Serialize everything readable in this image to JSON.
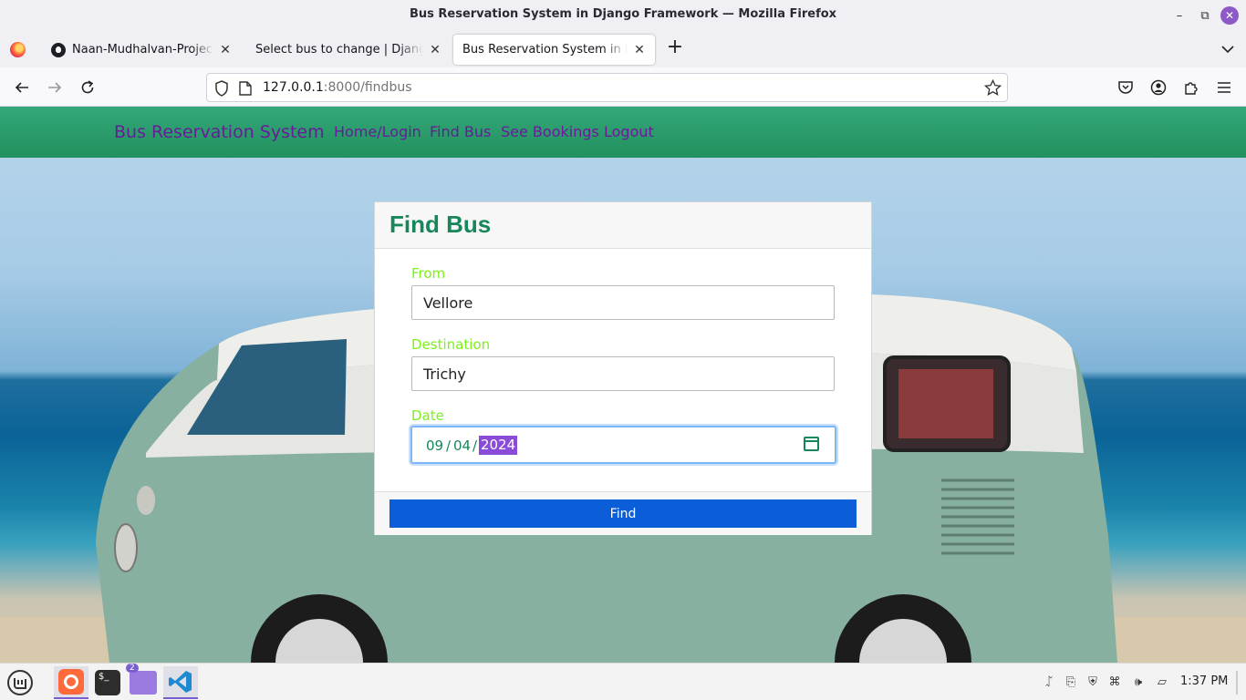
{
  "window": {
    "title": "Bus Reservation System in Django Framework — Mozilla Firefox"
  },
  "tabs": [
    {
      "label": "Naan-Mudhalvan-Project/Bus-Reservation-System"
    },
    {
      "label": "Select bus to change | Django site admin"
    },
    {
      "label": "Bus Reservation System in Django Framework"
    }
  ],
  "urlbar": {
    "host": "127.0.0.1",
    "path": ":8000/findbus"
  },
  "site": {
    "brand": "Bus Reservation System",
    "nav": [
      "Home/Login",
      "Find Bus",
      "See Bookings",
      "Logout"
    ]
  },
  "form": {
    "title": "Find Bus",
    "from_label": "From",
    "from_value": "Vellore",
    "destination_label": "Destination",
    "destination_value": "Trichy",
    "date_label": "Date",
    "date_month": "09",
    "date_day": "04",
    "date_year": "2024",
    "date_sep": "/",
    "submit_label": "Find"
  },
  "taskbar": {
    "files_badge": "2",
    "clock": "1:37 PM"
  },
  "colors": {
    "nav_green": "#22905d",
    "link_purple": "#6a1b9a",
    "label_green": "#7cf21a",
    "title_green": "#17875a",
    "button_blue": "#0b5ed7"
  }
}
